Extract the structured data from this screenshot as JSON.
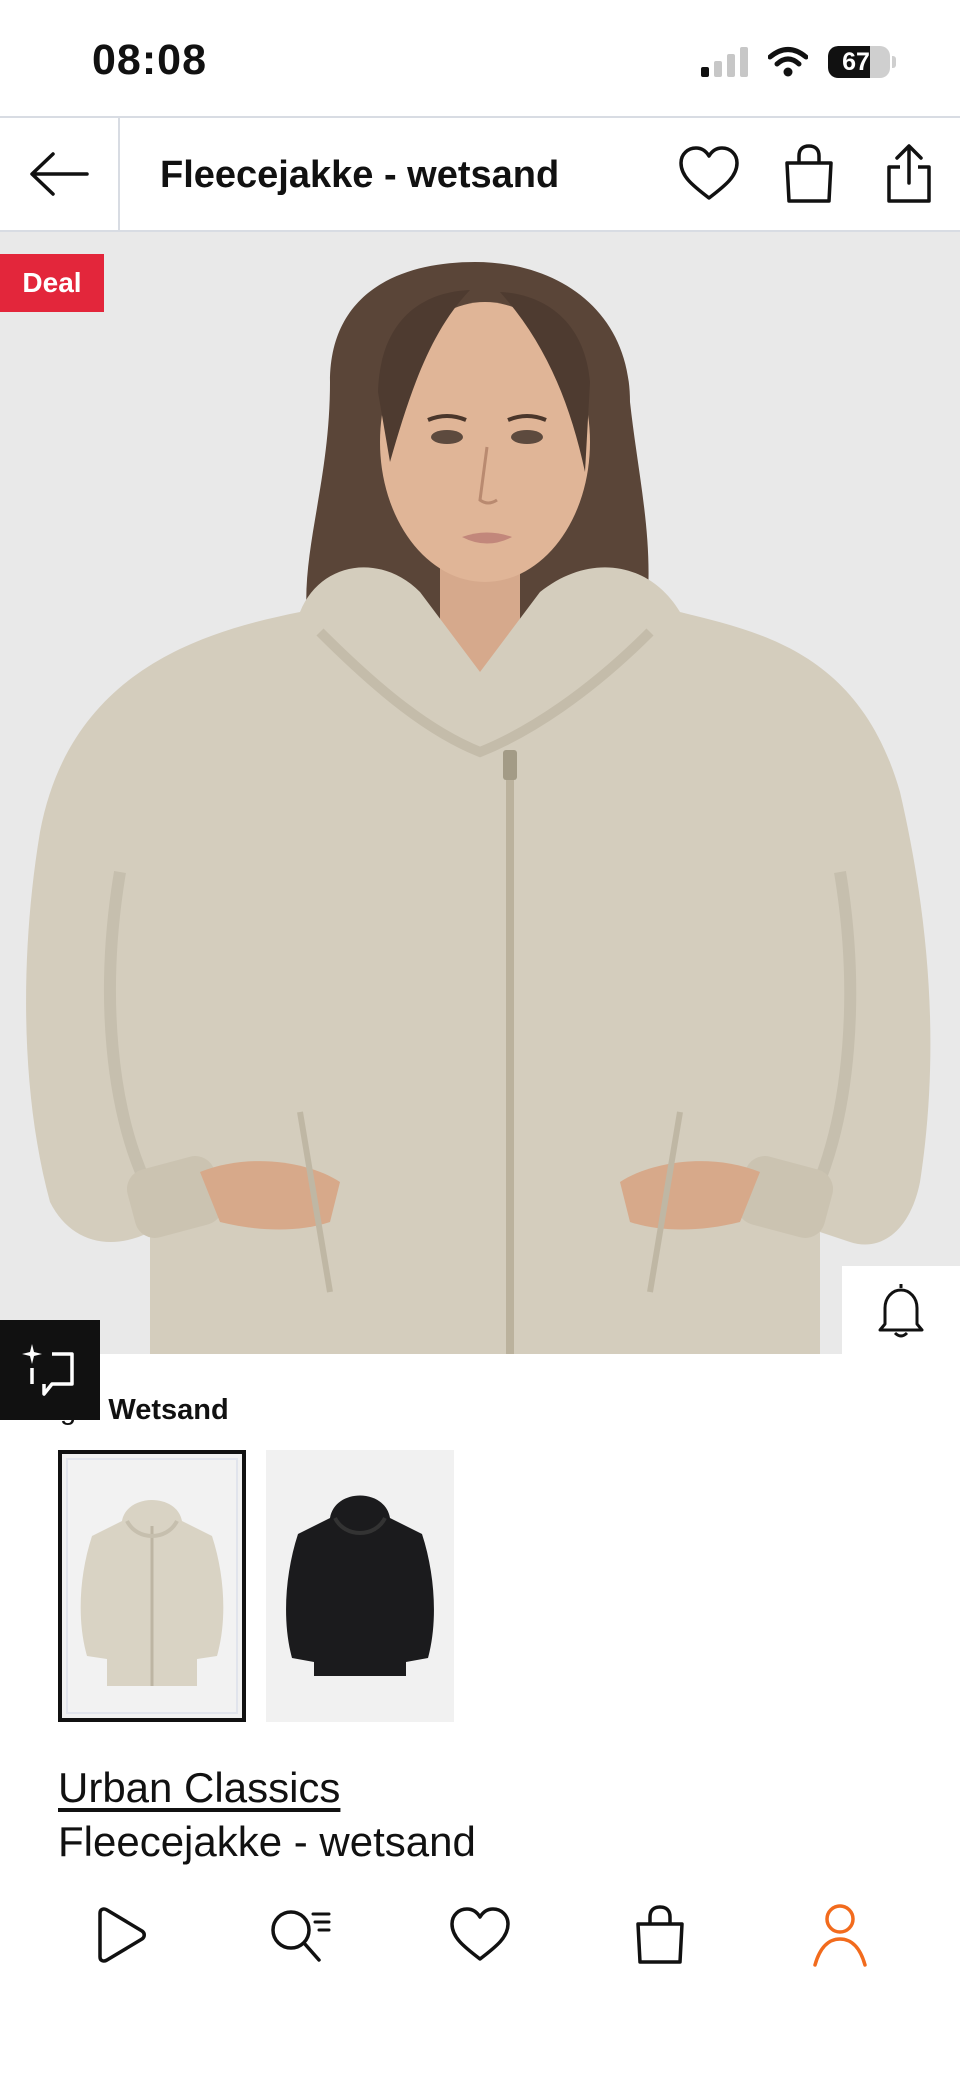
{
  "status_bar": {
    "time": "08:08",
    "battery_level": "67",
    "battery_percent": 67
  },
  "header": {
    "title": "Fleecejakke - wetsand",
    "icons": [
      "back-arrow-icon",
      "heart-icon",
      "shopping-bag-icon",
      "share-icon"
    ]
  },
  "product": {
    "badge": "Deal",
    "color_label_prefix": "ge: ",
    "color_value": "Wetsand",
    "swatches": [
      {
        "color_name": "wetsand",
        "color": "#d9d3c4",
        "selected": true
      },
      {
        "color_name": "black",
        "color": "#1b1b1d",
        "selected": false
      }
    ],
    "brand": "Urban Classics",
    "name": "Fleecejakke - wetsand"
  },
  "bottom_nav": {
    "items": [
      "home-play-icon",
      "search-menu-icon",
      "wishlist-heart-icon",
      "cart-bag-icon",
      "profile-icon"
    ],
    "active_color": "#f26b1d"
  },
  "colors": {
    "deal_badge": "#e3263b",
    "jacket": "#d4cdbd",
    "background_image": "#e9e9e9"
  }
}
